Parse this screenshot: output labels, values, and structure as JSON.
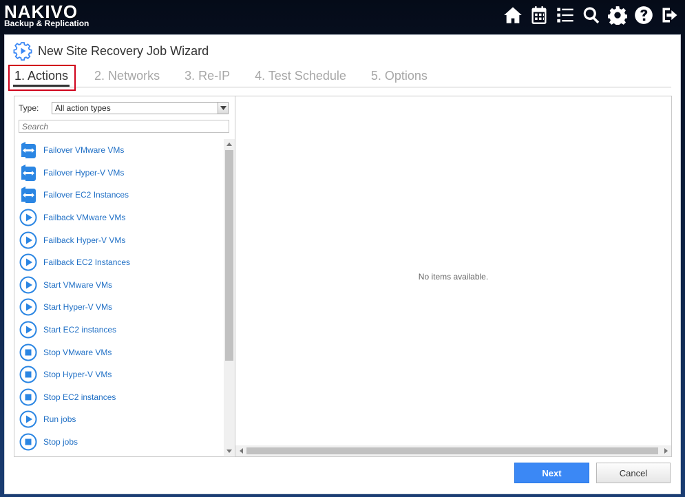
{
  "app": {
    "brand": "NAKIVO",
    "subtitle": "Backup & Replication",
    "top_icons": [
      "home-icon",
      "calendar-icon",
      "list-icon",
      "search-icon",
      "gear-icon",
      "help-icon",
      "logout-icon"
    ]
  },
  "dialog": {
    "title": "New Site Recovery Job Wizard",
    "steps": [
      {
        "label": "1. Actions",
        "active": true
      },
      {
        "label": "2. Networks",
        "active": false
      },
      {
        "label": "3. Re-IP",
        "active": false
      },
      {
        "label": "4. Test Schedule",
        "active": false
      },
      {
        "label": "5. Options",
        "active": false
      }
    ],
    "type_label": "Type:",
    "type_value": "All action types",
    "search_placeholder": "Search",
    "actions": [
      {
        "label": "Failover VMware VMs",
        "icon": "failover-icon"
      },
      {
        "label": "Failover Hyper-V VMs",
        "icon": "failover-icon"
      },
      {
        "label": "Failover EC2 Instances",
        "icon": "failover-icon"
      },
      {
        "label": "Failback VMware VMs",
        "icon": "play-icon"
      },
      {
        "label": "Failback Hyper-V VMs",
        "icon": "play-icon"
      },
      {
        "label": "Failback EC2 Instances",
        "icon": "play-icon"
      },
      {
        "label": "Start VMware VMs",
        "icon": "play-icon"
      },
      {
        "label": "Start Hyper-V VMs",
        "icon": "play-icon"
      },
      {
        "label": "Start EC2 instances",
        "icon": "play-icon"
      },
      {
        "label": "Stop VMware VMs",
        "icon": "stop-icon"
      },
      {
        "label": "Stop Hyper-V VMs",
        "icon": "stop-icon"
      },
      {
        "label": "Stop EC2 instances",
        "icon": "stop-icon"
      },
      {
        "label": "Run jobs",
        "icon": "play-icon"
      },
      {
        "label": "Stop jobs",
        "icon": "stop-icon"
      },
      {
        "label": "",
        "icon": "play-icon"
      }
    ],
    "empty_text": "No items available.",
    "next_label": "Next",
    "cancel_label": "Cancel"
  },
  "colors": {
    "accent": "#3b88f5",
    "link": "#1f6fc5",
    "highlight_box": "#d0021b"
  }
}
